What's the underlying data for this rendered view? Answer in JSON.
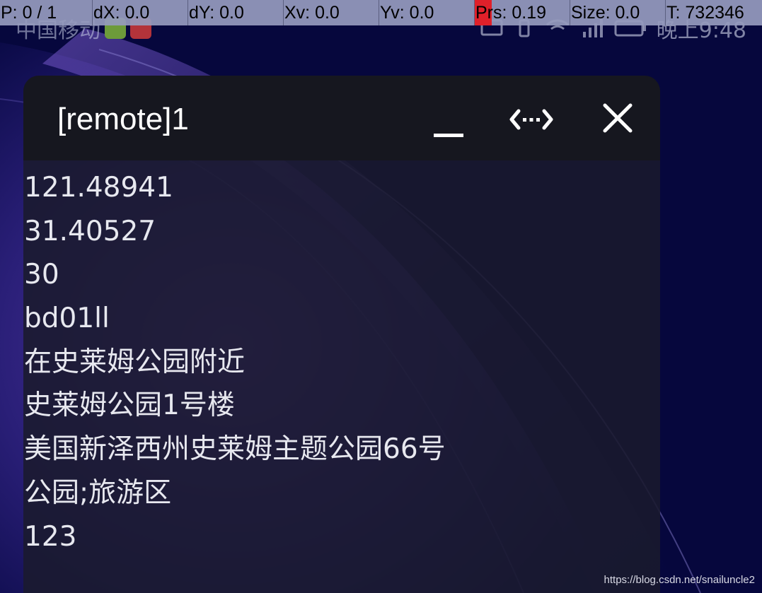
{
  "debug_bar": {
    "cells": [
      {
        "label": "P: 0 / 1"
      },
      {
        "label": "dX: 0.0"
      },
      {
        "label": "dY: 0.0"
      },
      {
        "label": "Xv: 0.0"
      },
      {
        "label": "Yv: 0.0"
      },
      {
        "label": "Prs: 0.19"
      },
      {
        "label": "Size: 0.0"
      },
      {
        "label": "T: 732346"
      }
    ]
  },
  "status_bar": {
    "carrier": "中国移动",
    "time": "晚上9:48",
    "icons": [
      "cast-icon",
      "vibrate-icon",
      "wifi-icon",
      "signal-icon",
      "battery-icon"
    ]
  },
  "window": {
    "title": "[remote]1",
    "buttons": {
      "minimize": "minimize-icon",
      "expand": "expand-arrows-icon",
      "close": "close-icon"
    },
    "lines": [
      "121.48941",
      "31.40527",
      "30",
      "bd01ll",
      "在史莱姆公园附近",
      "史莱姆公园1号楼",
      "美国新泽西州史莱姆主题公园66号",
      "公园;旅游区",
      "123"
    ]
  },
  "watermark": "https://blog.csdn.net/snailuncle2",
  "colors": {
    "title_bar": "#16171f",
    "content_bg": "#1a1a2e",
    "debug_bg": "#969bbe",
    "prs_highlight": "#e0202a",
    "wallpaper": "#0a0b45"
  }
}
